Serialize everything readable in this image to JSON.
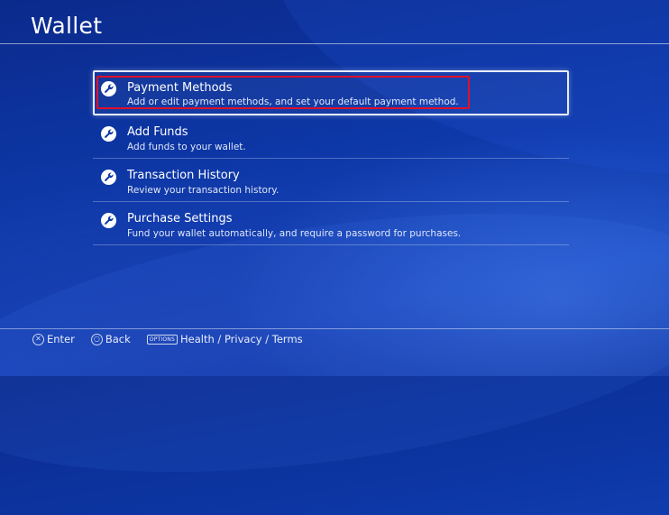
{
  "header": {
    "title": "Wallet"
  },
  "menu": {
    "items": [
      {
        "label": "Payment Methods",
        "description": "Add or edit payment methods, and set your default payment method.",
        "icon": "wrench-icon",
        "selected": true
      },
      {
        "label": "Add Funds",
        "description": "Add funds to your wallet.",
        "icon": "wrench-icon"
      },
      {
        "label": "Transaction History",
        "description": "Review your transaction history.",
        "icon": "wrench-icon"
      },
      {
        "label": "Purchase Settings",
        "description": "Fund your wallet automatically, and require a password for purchases.",
        "icon": "wrench-icon"
      }
    ]
  },
  "footer": {
    "enter_label": "Enter",
    "back_label": "Back",
    "options_key": "OPTIONS",
    "options_label": "Health / Privacy / Terms"
  },
  "colors": {
    "background": "#0d37a6",
    "highlight": "#e0102a",
    "selection": "#e8ecf6"
  }
}
